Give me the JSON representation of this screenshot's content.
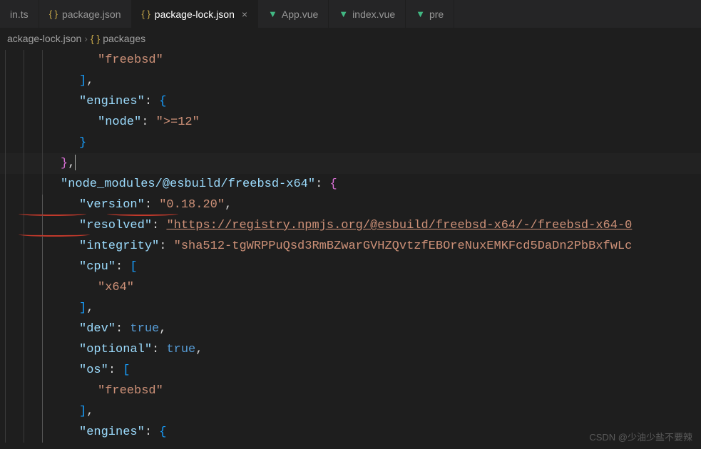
{
  "tabs": [
    {
      "name": "in.ts",
      "icon": ""
    },
    {
      "name": "package.json",
      "icon": "json"
    },
    {
      "name": "package-lock.json",
      "icon": "json",
      "active": true,
      "close": "×"
    },
    {
      "name": "App.vue",
      "icon": "vue"
    },
    {
      "name": "index.vue",
      "icon": "vue"
    },
    {
      "name": "pre",
      "icon": "vue"
    }
  ],
  "breadcrumbs": {
    "file": "ackage-lock.json",
    "sep": "›",
    "symbol_icon": "{ }",
    "symbol": "packages"
  },
  "code": {
    "l1_str": "\"freebsd\"",
    "l2_brkt": "]",
    "l2_comma": ",",
    "l3_key": "\"engines\"",
    "l3_colon": ":",
    "l3_brace": "{",
    "l4_key": "\"node\"",
    "l4_colon": ":",
    "l4_val": "\">=12\"",
    "l5_brace": "}",
    "l6_brace": "}",
    "l6_comma": ",",
    "l7_key": "\"node_modules/@esbuild/freebsd-x64\"",
    "l7_colon": ":",
    "l7_brace": "{",
    "l8_key": "\"version\"",
    "l8_colon": ":",
    "l8_val": "\"0.18.20\"",
    "l8_comma": ",",
    "l9_key": "\"resolved\"",
    "l9_colon": ":",
    "l9_val": "\"https://registry.npmjs.org/@esbuild/freebsd-x64/-/freebsd-x64-0",
    "l10_key": "\"integrity\"",
    "l10_colon": ":",
    "l10_val": "\"sha512-tgWRPPuQsd3RmBZwarGVHZQvtzfEBOreNuxEMKFcd5DaDn2PbBxfwLc",
    "l11_key": "\"cpu\"",
    "l11_colon": ":",
    "l11_brkt": "[",
    "l12_val": "\"x64\"",
    "l13_brkt": "]",
    "l13_comma": ",",
    "l14_key": "\"dev\"",
    "l14_colon": ":",
    "l14_val": "true",
    "l14_comma": ",",
    "l15_key": "\"optional\"",
    "l15_colon": ":",
    "l15_val": "true",
    "l15_comma": ",",
    "l16_key": "\"os\"",
    "l16_colon": ":",
    "l16_brkt": "[",
    "l17_val": "\"freebsd\"",
    "l18_brkt": "]",
    "l18_comma": ",",
    "l19_key": "\"engines\"",
    "l19_colon": ":",
    "l19_brace": "{"
  },
  "watermark": "CSDN @少油少盐不要辣"
}
